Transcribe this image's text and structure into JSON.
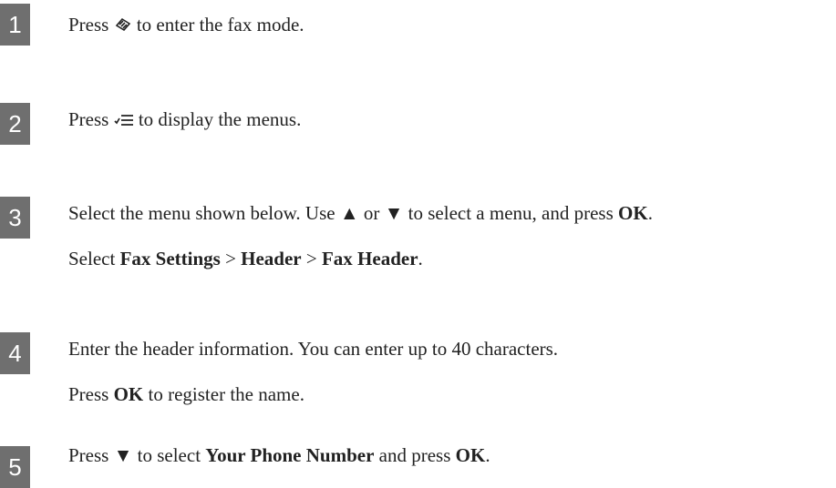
{
  "steps": [
    {
      "number": "1",
      "lines": [
        {
          "before": "Press ",
          "icon": "fax-icon",
          "after": " to enter the fax mode."
        }
      ]
    },
    {
      "number": "2",
      "lines": [
        {
          "before": "Press ",
          "icon": "menu-icon",
          "after": " to display the menus."
        }
      ]
    },
    {
      "number": "3",
      "line1": {
        "t1": "Select the menu shown below. Use ",
        "up": "▲",
        "t2": " or ",
        "down": "▼",
        "t3": " to select a menu, and press ",
        "ok": "OK",
        "t4": "."
      },
      "line2": {
        "t1": "Select ",
        "b1": "Fax Settings",
        "sep1": " > ",
        "b2": "Header",
        "sep2": " > ",
        "b3": "Fax Header",
        "t2": "."
      }
    },
    {
      "number": "4",
      "line1": "Enter the header information. You can enter up to 40 characters.",
      "line2": {
        "t1": "Press ",
        "ok": "OK",
        "t2": " to register the name."
      }
    },
    {
      "number": "5",
      "line1": {
        "t1": "Press ",
        "down": "▼",
        "t2": " to select ",
        "b1": "Your Phone Number",
        "t3": " and press ",
        "ok": "OK",
        "t4": "."
      }
    }
  ]
}
